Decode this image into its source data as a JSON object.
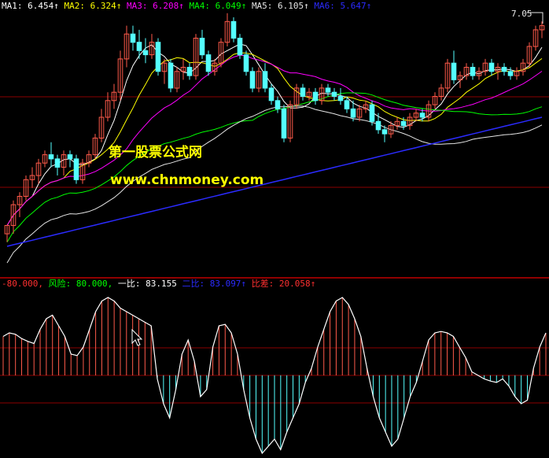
{
  "colors": {
    "background": "#000000",
    "up": "#ff5a4a",
    "down": "#54ffff",
    "ma1": "#ffffff",
    "ma2": "#ffff00",
    "ma3": "#ff00ff",
    "ma4": "#00ff00",
    "ma5": "#e6e6e6",
    "ma6": "#2b2bff",
    "grid": "#8b0000",
    "divider": "#c00000",
    "watermark": "#ffff00"
  },
  "top_legend": [
    {
      "label": "MA1: ",
      "value": "6.454↑",
      "color": "#ffffff"
    },
    {
      "label": "MA2: ",
      "value": "6.324↑",
      "color": "#ffff00"
    },
    {
      "label": "MA3: ",
      "value": "6.208↑",
      "color": "#ff00ff"
    },
    {
      "label": "MA4: ",
      "value": "6.049↑",
      "color": "#00ff00"
    },
    {
      "label": "MA5: ",
      "value": "6.105↑",
      "color": "#e6e6e6"
    },
    {
      "label": "MA6: ",
      "value": "5.647↑",
      "color": "#2b2bff"
    }
  ],
  "price_high_label": "7.05",
  "watermark": {
    "line1": "第一股票公式网",
    "line2": "www.chnmoney.com"
  },
  "indicator_legend": [
    {
      "text": "-80.000,",
      "color": "#ff3030"
    },
    {
      "text": "风险: 80.000,",
      "color": "#00ff00"
    },
    {
      "text": "一比: 83.155",
      "color": "#ffffff"
    },
    {
      "text": "二比: 83.097↑",
      "color": "#2b2bff"
    },
    {
      "text": "比差: 20.058↑",
      "color": "#ff3030"
    }
  ],
  "chart_data": {
    "type": "line",
    "candles": [
      [
        4.5,
        4.6,
        4.4,
        4.6
      ],
      [
        4.6,
        4.9,
        4.5,
        4.85
      ],
      [
        4.85,
        5.0,
        4.7,
        4.95
      ],
      [
        4.95,
        5.2,
        4.9,
        5.15
      ],
      [
        5.15,
        5.3,
        5.05,
        5.2
      ],
      [
        5.2,
        5.4,
        5.1,
        5.35
      ],
      [
        5.35,
        5.5,
        5.3,
        5.45
      ],
      [
        5.45,
        5.6,
        5.3,
        5.4
      ],
      [
        5.4,
        5.45,
        5.2,
        5.3
      ],
      [
        5.3,
        5.5,
        5.2,
        5.45
      ],
      [
        5.45,
        5.5,
        5.3,
        5.4
      ],
      [
        5.4,
        5.45,
        5.1,
        5.15
      ],
      [
        5.15,
        5.4,
        5.1,
        5.35
      ],
      [
        5.35,
        5.5,
        5.3,
        5.45
      ],
      [
        5.45,
        5.7,
        5.4,
        5.65
      ],
      [
        5.65,
        6.0,
        5.6,
        5.9
      ],
      [
        5.9,
        6.2,
        5.85,
        6.1
      ],
      [
        6.1,
        6.3,
        6.0,
        6.2
      ],
      [
        6.2,
        6.7,
        6.1,
        6.6
      ],
      [
        6.6,
        7.0,
        6.5,
        6.9
      ],
      [
        6.9,
        7.0,
        6.7,
        6.8
      ],
      [
        6.8,
        6.95,
        6.6,
        6.7
      ],
      [
        6.7,
        6.85,
        6.55,
        6.65
      ],
      [
        6.65,
        6.9,
        6.6,
        6.8
      ],
      [
        6.8,
        6.85,
        6.4,
        6.45
      ],
      [
        6.45,
        6.6,
        6.3,
        6.55
      ],
      [
        6.55,
        6.6,
        6.2,
        6.25
      ],
      [
        6.25,
        6.5,
        6.2,
        6.45
      ],
      [
        6.45,
        6.6,
        6.35,
        6.5
      ],
      [
        6.5,
        6.55,
        6.35,
        6.4
      ],
      [
        6.4,
        6.9,
        6.35,
        6.85
      ],
      [
        6.85,
        6.95,
        6.6,
        6.65
      ],
      [
        6.65,
        6.7,
        6.4,
        6.45
      ],
      [
        6.45,
        6.6,
        6.4,
        6.55
      ],
      [
        6.55,
        6.85,
        6.5,
        6.8
      ],
      [
        6.8,
        7.15,
        6.75,
        7.05
      ],
      [
        7.05,
        7.1,
        6.8,
        6.85
      ],
      [
        6.85,
        6.9,
        6.6,
        6.65
      ],
      [
        6.65,
        6.7,
        6.4,
        6.45
      ],
      [
        6.45,
        6.5,
        6.2,
        6.25
      ],
      [
        6.25,
        6.5,
        6.2,
        6.45
      ],
      [
        6.45,
        6.55,
        6.2,
        6.25
      ],
      [
        6.25,
        6.3,
        6.05,
        6.1
      ],
      [
        6.1,
        6.15,
        5.95,
        6.0
      ],
      [
        6.0,
        6.05,
        5.6,
        5.65
      ],
      [
        5.65,
        6.1,
        5.6,
        6.05
      ],
      [
        6.05,
        6.3,
        6.0,
        6.25
      ],
      [
        6.25,
        6.3,
        6.1,
        6.15
      ],
      [
        6.15,
        6.25,
        6.1,
        6.2
      ],
      [
        6.2,
        6.25,
        6.05,
        6.1
      ],
      [
        6.1,
        6.3,
        6.05,
        6.25
      ],
      [
        6.25,
        6.3,
        6.15,
        6.2
      ],
      [
        6.2,
        6.25,
        6.1,
        6.15
      ],
      [
        6.15,
        6.25,
        6.05,
        6.1
      ],
      [
        6.1,
        6.15,
        5.95,
        6.0
      ],
      [
        6.0,
        6.1,
        5.85,
        5.9
      ],
      [
        5.9,
        6.05,
        5.85,
        6.0
      ],
      [
        6.0,
        6.1,
        5.95,
        6.05
      ],
      [
        6.05,
        6.1,
        5.8,
        5.85
      ],
      [
        5.85,
        5.95,
        5.7,
        5.75
      ],
      [
        5.75,
        5.8,
        5.6,
        5.7
      ],
      [
        5.7,
        5.85,
        5.65,
        5.8
      ],
      [
        5.8,
        5.9,
        5.75,
        5.85
      ],
      [
        5.85,
        5.9,
        5.75,
        5.8
      ],
      [
        5.8,
        5.95,
        5.75,
        5.9
      ],
      [
        5.9,
        6.0,
        5.85,
        5.95
      ],
      [
        5.95,
        6.0,
        5.85,
        5.9
      ],
      [
        5.9,
        6.1,
        5.85,
        6.05
      ],
      [
        6.05,
        6.2,
        6.0,
        6.15
      ],
      [
        6.15,
        6.3,
        6.1,
        6.25
      ],
      [
        6.25,
        6.6,
        6.2,
        6.55
      ],
      [
        6.55,
        6.7,
        6.3,
        6.35
      ],
      [
        6.35,
        6.45,
        6.25,
        6.4
      ],
      [
        6.4,
        6.55,
        6.35,
        6.5
      ],
      [
        6.5,
        6.55,
        6.35,
        6.4
      ],
      [
        6.4,
        6.5,
        6.35,
        6.45
      ],
      [
        6.45,
        6.6,
        6.4,
        6.55
      ],
      [
        6.55,
        6.6,
        6.4,
        6.45
      ],
      [
        6.45,
        6.55,
        6.35,
        6.5
      ],
      [
        6.5,
        6.55,
        6.4,
        6.45
      ],
      [
        6.45,
        6.5,
        6.35,
        6.4
      ],
      [
        6.4,
        6.5,
        6.35,
        6.45
      ],
      [
        6.45,
        6.6,
        6.4,
        6.55
      ],
      [
        6.55,
        6.8,
        6.5,
        6.75
      ],
      [
        6.75,
        7.0,
        6.7,
        6.95
      ],
      [
        6.95,
        7.05,
        6.85,
        7.0
      ]
    ],
    "oscillator": [
      55,
      60,
      58,
      52,
      48,
      45,
      65,
      80,
      85,
      70,
      55,
      30,
      28,
      40,
      65,
      90,
      105,
      110,
      105,
      95,
      90,
      85,
      80,
      75,
      70,
      -5,
      -40,
      -60,
      -20,
      30,
      50,
      20,
      -30,
      -20,
      40,
      70,
      72,
      60,
      30,
      -20,
      -60,
      -90,
      -110,
      -100,
      -90,
      -105,
      -80,
      -60,
      -40,
      -10,
      10,
      40,
      65,
      90,
      105,
      110,
      100,
      80,
      55,
      10,
      -30,
      -60,
      -80,
      -100,
      -90,
      -60,
      -30,
      -10,
      20,
      50,
      60,
      62,
      60,
      55,
      40,
      25,
      5,
      0,
      -5,
      -8,
      -10,
      -5,
      -15,
      -30,
      -40,
      -35,
      10,
      40,
      60
    ]
  }
}
